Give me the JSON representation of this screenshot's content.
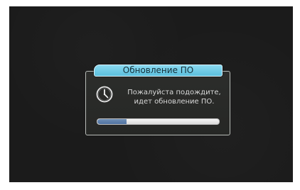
{
  "dialog": {
    "title": "Обновление ПО",
    "message_line1": "Пожалуйста подождите,",
    "message_line2": "идет обновление ПО.",
    "icon": "clock-icon",
    "progress_percent": 24
  },
  "colors": {
    "screen_background": "#1b1b1b",
    "title_tab": "#6dcae7",
    "progress_fill": "#5a7cab"
  }
}
